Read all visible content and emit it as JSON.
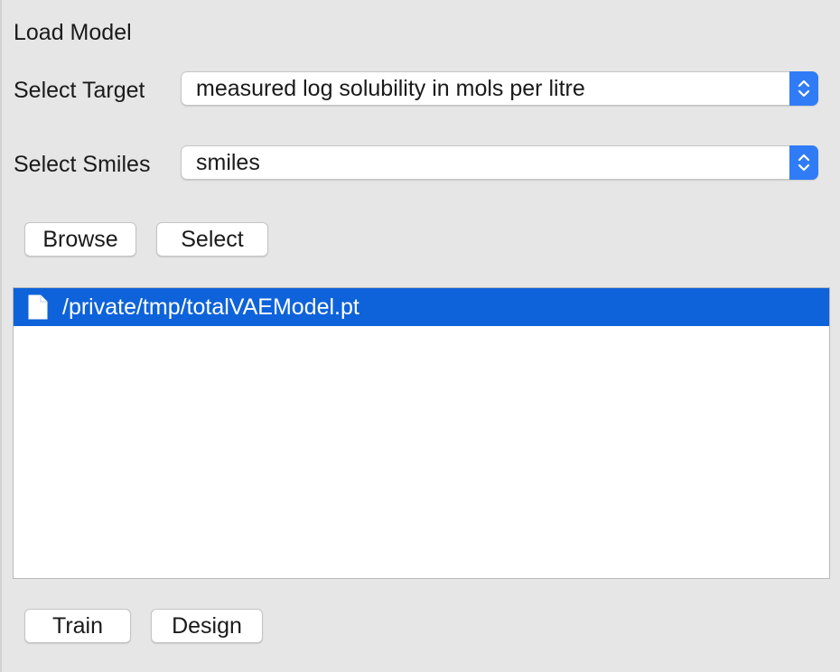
{
  "title": "Load Model",
  "target": {
    "label": "Select Target",
    "value": "measured log solubility in mols per litre"
  },
  "smiles": {
    "label": "Select Smiles",
    "value": "smiles"
  },
  "buttons": {
    "browse": "Browse",
    "select": "Select",
    "train": "Train",
    "design": "Design"
  },
  "file_list": {
    "items": [
      {
        "name": "/private/tmp/totalVAEModel.pt",
        "icon": "document-icon",
        "selected": true
      }
    ],
    "selection_color": "#0e63da"
  },
  "colors": {
    "accent": "#2f7cf6",
    "background": "#e6e6e6"
  }
}
